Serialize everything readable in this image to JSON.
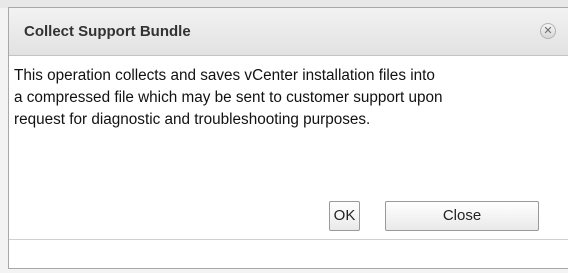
{
  "dialog": {
    "title": "Collect Support Bundle",
    "close_glyph": "✕",
    "close_icon": "close-circle-icon",
    "message_lines": [
      "This operation collects and saves vCenter installation files into",
      "a compressed file which may be sent to customer support upon",
      "request for diagnostic and troubleshooting purposes."
    ],
    "ok_label": "OK",
    "close_label": "Close"
  },
  "colors": {
    "titlebar_top": "#f2f2f2",
    "titlebar_bottom": "#e2e2e2",
    "border": "#a8a8a8",
    "text": "#111111"
  }
}
